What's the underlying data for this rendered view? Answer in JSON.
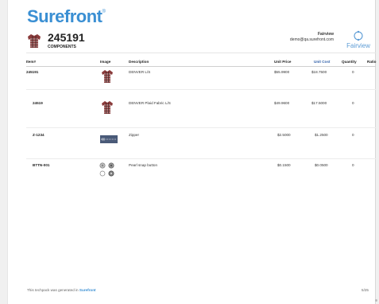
{
  "brand": {
    "name": "Surefront",
    "mark": "®"
  },
  "header": {
    "style_number": "245191",
    "section": "COMPONENTS",
    "user_company": "Fairview",
    "user_email": "demo@qa.surefront.com",
    "partner_logo_text": "Fairview"
  },
  "table": {
    "columns": [
      "Item#",
      "Image",
      "Description",
      "Unit Price",
      "Unit Cost",
      "Quantity",
      "Ratio"
    ],
    "rows": [
      {
        "item": "245191",
        "image": "plaid-shirt",
        "description": "DENVER L/S",
        "unit_price": "$55.9900",
        "unit_cost": "$18.7500",
        "quantity": "0",
        "ratio": ""
      },
      {
        "item": "24519",
        "image": "plaid-shirt",
        "description": "DENVER Plaid Fabric L/S",
        "unit_price": "$49.9600",
        "unit_cost": "$17.5000",
        "quantity": "0",
        "ratio": ""
      },
      {
        "item": "Z-1234",
        "image": "zipper",
        "description": "Zipper",
        "unit_price": "$2.5000",
        "unit_cost": "$1.2500",
        "quantity": "0",
        "ratio": ""
      },
      {
        "item": "BTTN-001",
        "image": "snap-buttons",
        "description": "Pearl snap button",
        "unit_price": "$0.1500",
        "unit_cost": "$0.0500",
        "quantity": "0",
        "ratio": ""
      }
    ]
  },
  "footer": {
    "text": "This techpack was generated in",
    "link": "Surefront",
    "page": "5/25"
  },
  "colors": {
    "brand": "#3a8fd3",
    "unit_cost_header": "#2f5fa8",
    "partner_logo": "#5b9bd5"
  }
}
